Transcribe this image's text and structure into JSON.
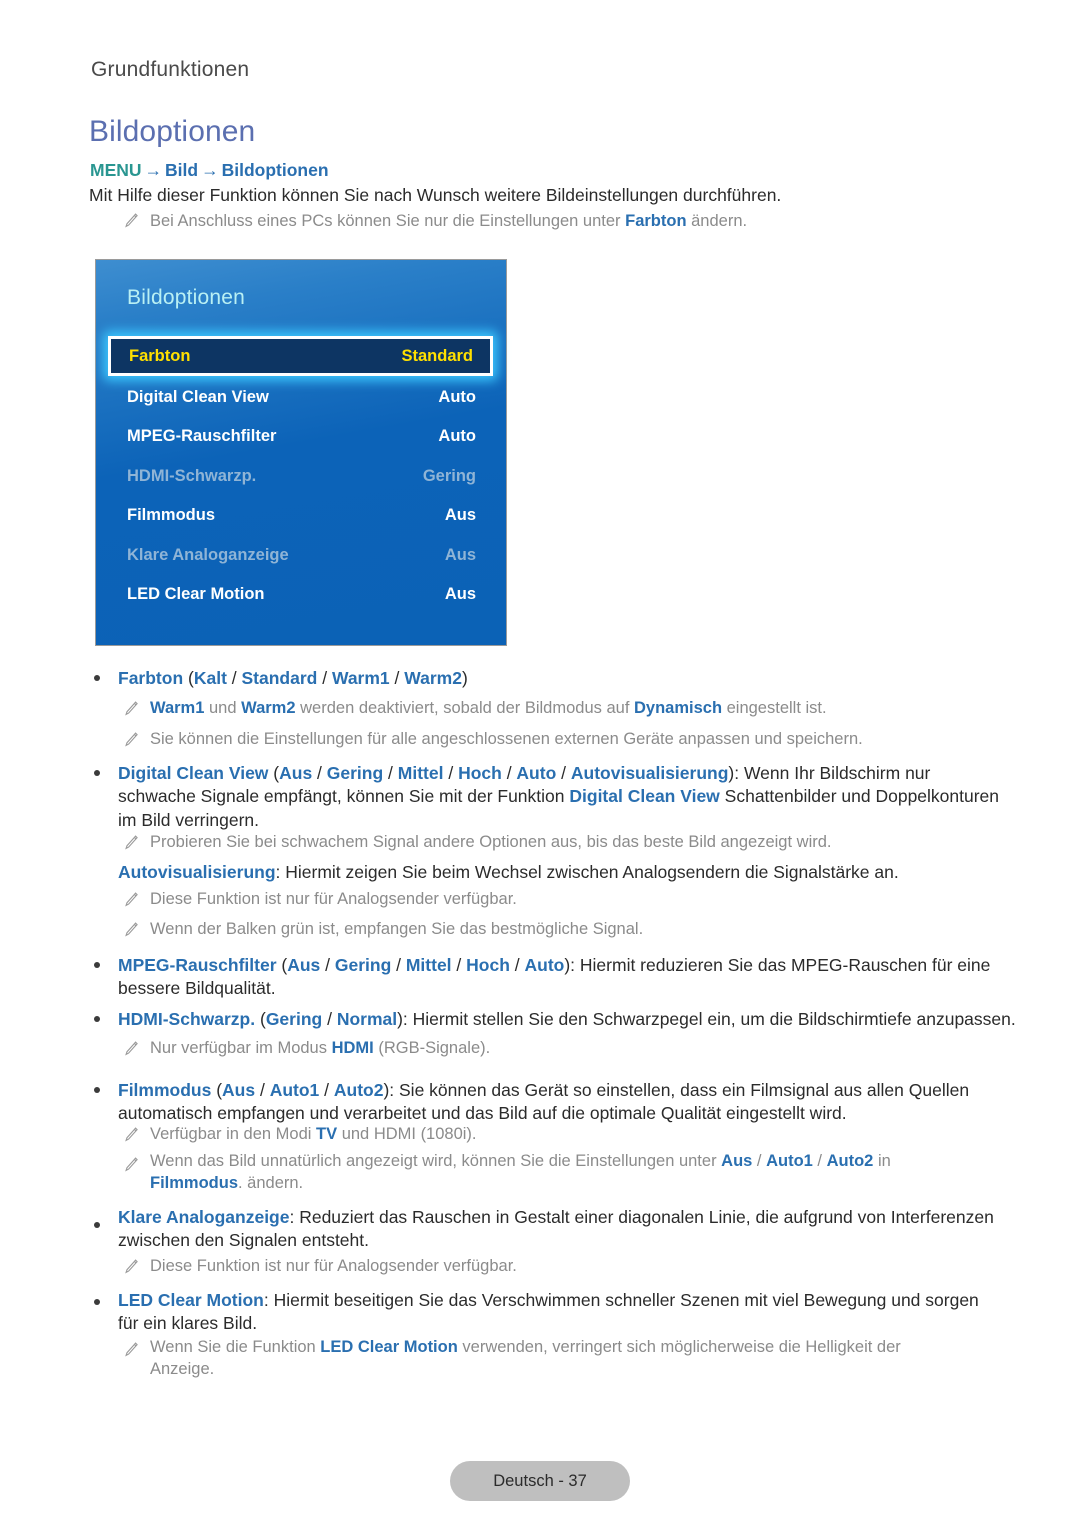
{
  "header": {
    "chapter": "Grundfunktionen",
    "title": "Bildoptionen",
    "menu_path": {
      "menu": "MENU",
      "arrow": "→",
      "level1": "Bild",
      "level2": "Bildoptionen"
    },
    "intro": "Mit Hilfe dieser Funktion können Sie nach Wunsch weitere Bildeinstellungen durchführen.",
    "intro_note": {
      "pre": "Bei Anschluss eines PCs können Sie nur die Einstellungen unter ",
      "link": "Farbton",
      "post": " ändern."
    }
  },
  "osd": {
    "title": "Bildoptionen",
    "selected": {
      "label": "Farbton",
      "value": "Standard"
    },
    "rows": [
      {
        "label": "Digital Clean View",
        "value": "Auto",
        "dim": false
      },
      {
        "label": "MPEG-Rauschfilter",
        "value": "Auto",
        "dim": false
      },
      {
        "label": "HDMI-Schwarzp.",
        "value": "Gering",
        "dim": true
      },
      {
        "label": "Filmmodus",
        "value": "Aus",
        "dim": false
      },
      {
        "label": "Klare Analoganzeige",
        "value": "Aus",
        "dim": true
      },
      {
        "label": "LED Clear Motion",
        "value": "Aus",
        "dim": false
      }
    ],
    "colors": {
      "panel_top": "#3e8ed0",
      "panel_bottom": "#0b62b6",
      "title_text": "#b9f0f4",
      "selected_bg": "#0d3563",
      "selected_text": "#ffe000",
      "glow": "#3cc8ff",
      "dim_text": "#8fb4d6"
    }
  },
  "body": {
    "b1": {
      "t1": "Farbton",
      "t2": " (",
      "t3": "Kalt",
      "t4": " / ",
      "t5": "Standard",
      "t6": " / ",
      "t7": "Warm1",
      "t8": " / ",
      "t9": "Warm2",
      "t10": ")"
    },
    "n1": {
      "a": "Warm1",
      "b": " und ",
      "c": "Warm2",
      "d": " werden deaktiviert, sobald der Bildmodus auf ",
      "e": "Dynamisch",
      "f": " eingestellt ist."
    },
    "n2": "Sie können die Einstellungen für alle angeschlossenen externen Geräte anpassen und speichern.",
    "b2": {
      "name": "Digital Clean View",
      "open": " (",
      "o1": "Aus",
      "s1": " / ",
      "o2": "Gering",
      "s2": " / ",
      "o3": "Mittel",
      "s3": " / ",
      "o4": "Hoch",
      "s4": " / ",
      "o5": "Auto",
      "s5": " / ",
      "o6": "Autovisualisierung",
      "close": "): Wenn Ihr Bildschirm nur schwache Signale empfängt, können Sie mit der Funktion ",
      "ref": "Digital Clean View",
      "tail": " Schattenbilder und Doppelkonturen im Bild verringern."
    },
    "n3": "Probieren Sie bei schwachem Signal andere Optionen aus, bis das beste Bild angezeigt wird.",
    "p1": {
      "name": "Autovisualisierung",
      "rest": ": Hiermit zeigen Sie beim Wechsel zwischen Analogsendern die Signalstärke an."
    },
    "n4": "Diese Funktion ist nur für Analogsender verfügbar.",
    "n5": "Wenn der Balken grün ist, empfangen Sie das bestmögliche Signal.",
    "b3": {
      "name": "MPEG-Rauschfilter",
      "open": " (",
      "o1": "Aus",
      "s1": " / ",
      "o2": "Gering",
      "s2": " / ",
      "o3": "Mittel",
      "s3": " / ",
      "o4": "Hoch",
      "s4": " / ",
      "o5": "Auto",
      "close": "): Hiermit reduzieren Sie das MPEG-Rauschen für eine bessere Bildqualität."
    },
    "b4": {
      "name": "HDMI-Schwarzp.",
      "open": " (",
      "o1": "Gering",
      "s1": " / ",
      "o2": "Normal",
      "close": "): Hiermit stellen Sie den Schwarzpegel ein, um die Bildschirmtiefe anzupassen."
    },
    "n6": {
      "pre": "Nur verfügbar im Modus ",
      "link": "HDMI",
      "post": " (RGB-Signale)."
    },
    "b5": {
      "name": "Filmmodus",
      "open": " (",
      "o1": "Aus",
      "s1": " / ",
      "o2": "Auto1",
      "s2": " / ",
      "o3": "Auto2",
      "close": "): Sie können das Gerät so einstellen, dass ein Filmsignal aus allen Quellen automatisch empfangen und verarbeitet und das Bild auf die optimale Qualität eingestellt wird."
    },
    "n7": {
      "pre": "Verfügbar in den Modi ",
      "link": "TV",
      "post": " und HDMI (1080i)."
    },
    "n8": {
      "pre": "Wenn das Bild unnatürlich angezeigt wird, können Sie die Einstellungen unter ",
      "o1": "Aus",
      "s1": " / ",
      "o2": "Auto1",
      "s2": " / ",
      "o3": "Auto2",
      "mid": " in ",
      "ref": "Filmmodus",
      "post": ". ändern."
    },
    "b6": {
      "name": "Klare Analoganzeige",
      "close": ": Reduziert das Rauschen in Gestalt einer diagonalen Linie, die aufgrund von Interferenzen zwischen den Signalen entsteht."
    },
    "n9": "Diese Funktion ist nur für Analogsender verfügbar.",
    "b7": {
      "name": "LED Clear Motion",
      "close": ": Hiermit beseitigen Sie das Verschwimmen schneller Szenen mit viel Bewegung und sorgen für ein klares Bild."
    },
    "n10": {
      "pre": "Wenn Sie die Funktion ",
      "link": "LED Clear Motion",
      "post": " verwenden, verringert sich möglicherweise die Helligkeit der Anzeige."
    }
  },
  "footer": {
    "label": "Deutsch - 37"
  }
}
